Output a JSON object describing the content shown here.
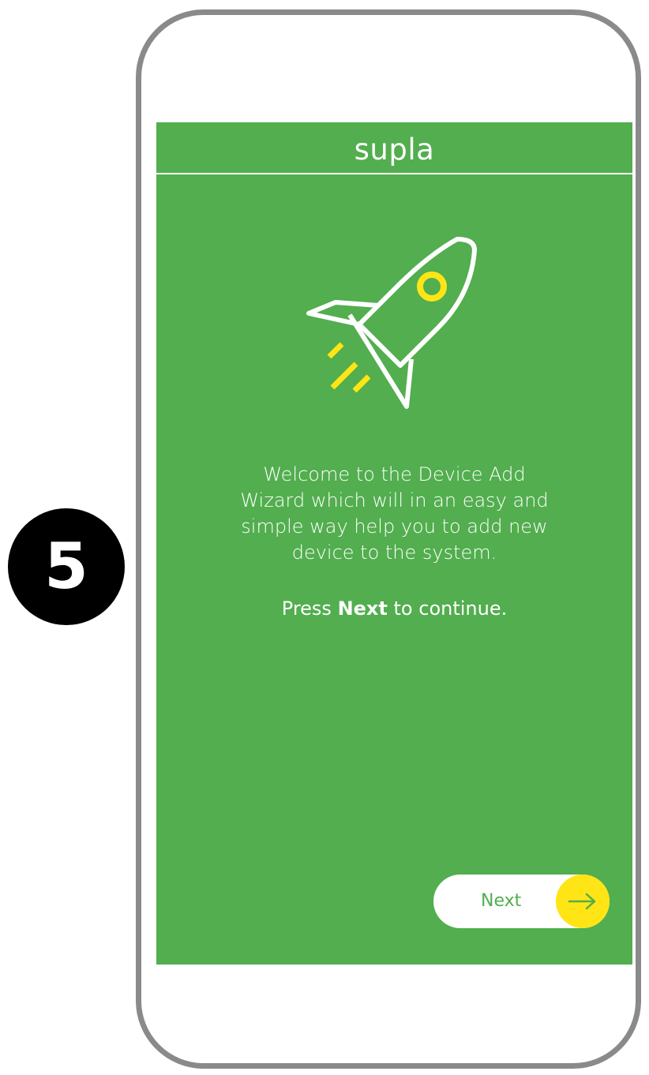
{
  "step": {
    "number": "5"
  },
  "app": {
    "title": "supla"
  },
  "welcome": {
    "lines": [
      "Welcome to the Device Add",
      "Wizard which will in an easy and",
      "simple way help you to add new",
      "device to the system."
    ],
    "press_prefix": "Press ",
    "press_bold": "Next",
    "press_suffix": " to continue."
  },
  "next_button": {
    "label": "Next"
  },
  "icons": {
    "rocket": "rocket-icon",
    "arrow": "arrow-right-icon"
  },
  "colors": {
    "screen_background": "#52ae4e",
    "accent_yellow": "#ffe515",
    "frame_gray": "#8a8a8a",
    "badge_black": "#000000"
  }
}
